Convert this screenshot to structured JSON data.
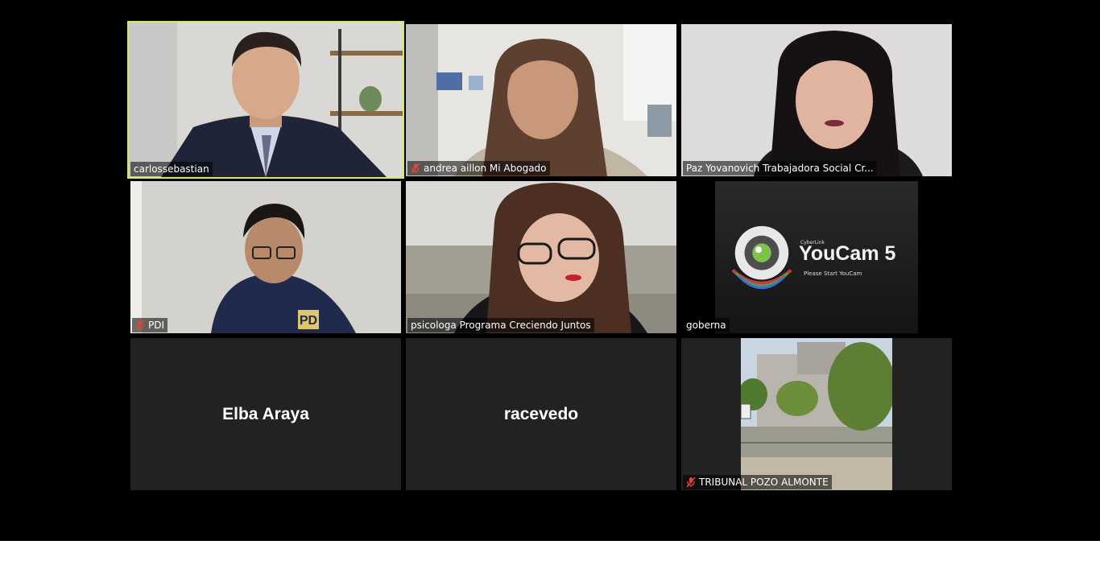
{
  "participants": [
    {
      "name": "carlossebastian",
      "muted": false,
      "active_speaker": true,
      "video": "camera"
    },
    {
      "name": "andrea aillon Mi Abogado",
      "muted": true,
      "video": "camera"
    },
    {
      "name": "Paz Yovanovich Trabajadora Social Cr...",
      "muted": false,
      "video": "camera"
    },
    {
      "name": "PDI",
      "muted": true,
      "video": "camera"
    },
    {
      "name": "psicologa Programa Creciendo Juntos",
      "muted": false,
      "video": "camera"
    },
    {
      "name": "goberna",
      "muted": false,
      "video": "youcam"
    },
    {
      "name": "Elba Araya",
      "muted": false,
      "video": "off"
    },
    {
      "name": "racevedo",
      "muted": false,
      "video": "off"
    },
    {
      "name": "TRIBUNAL POZO ALMONTE",
      "muted": true,
      "video": "camera"
    }
  ],
  "youcam": {
    "brand": "CyberLink",
    "product": "YouCam 5",
    "message": "Please Start YouCam"
  },
  "pdi_badge": "PD",
  "colors": {
    "active_border": "#d3e96a",
    "tile_bg": "#222222",
    "muted_icon": "#e0453a"
  }
}
